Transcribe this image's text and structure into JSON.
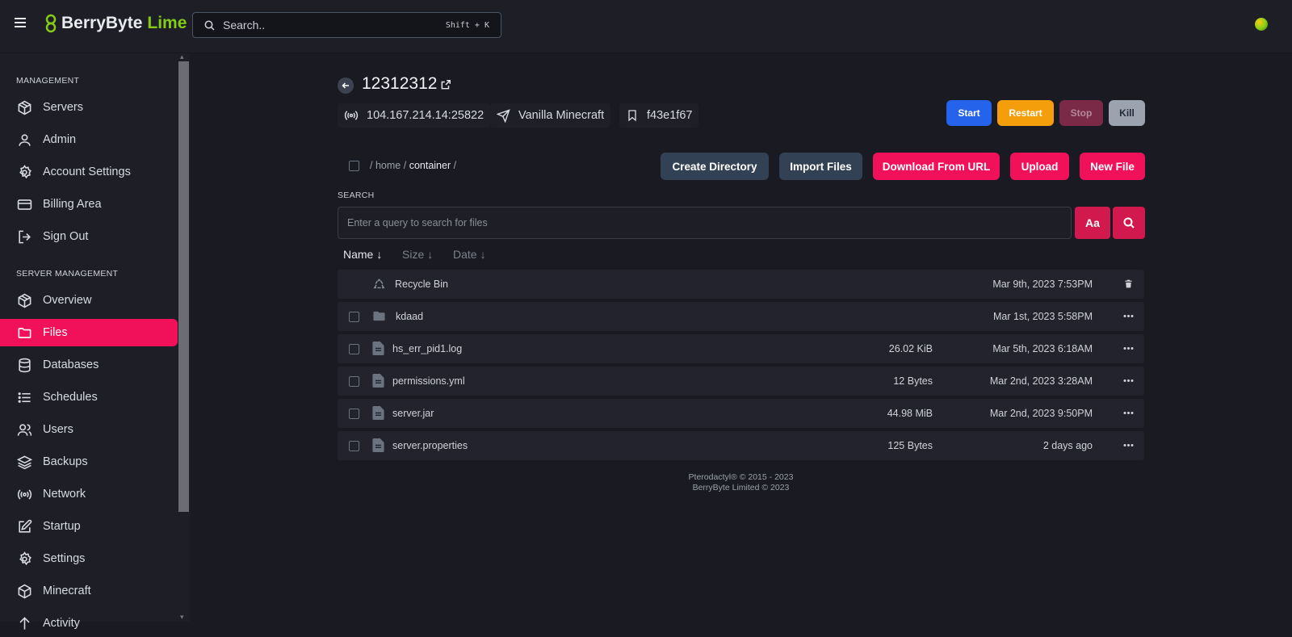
{
  "app": {
    "brand_name": "BerryByte",
    "brand_suffix": "Lime",
    "search_placeholder": "Search..",
    "search_shortcut": "Shift + K"
  },
  "sidebar": {
    "management_label": "MANAGEMENT",
    "management_items": [
      {
        "label": "Servers",
        "icon": "cube-icon"
      },
      {
        "label": "Admin",
        "icon": "user-icon"
      },
      {
        "label": "Account Settings",
        "icon": "gear-icon"
      },
      {
        "label": "Billing Area",
        "icon": "credit-card-icon"
      },
      {
        "label": "Sign Out",
        "icon": "sign-out-icon"
      }
    ],
    "server_label": "SERVER MANAGEMENT",
    "server_items": [
      {
        "label": "Overview",
        "icon": "cube-icon"
      },
      {
        "label": "Files",
        "icon": "folder-icon",
        "active": true
      },
      {
        "label": "Databases",
        "icon": "database-icon"
      },
      {
        "label": "Schedules",
        "icon": "list-icon"
      },
      {
        "label": "Users",
        "icon": "users-icon"
      },
      {
        "label": "Backups",
        "icon": "layers-icon"
      },
      {
        "label": "Network",
        "icon": "broadcast-icon"
      },
      {
        "label": "Startup",
        "icon": "edit-icon"
      },
      {
        "label": "Settings",
        "icon": "gear-icon"
      },
      {
        "label": "Minecraft",
        "icon": "box-icon"
      },
      {
        "label": "Activity",
        "icon": "activity-icon"
      }
    ]
  },
  "server": {
    "name": "12312312",
    "address": "104.167.214.14:25822",
    "egg": "Vanilla Minecraft",
    "id": "f43e1f67"
  },
  "power": {
    "start": "Start",
    "restart": "Restart",
    "stop": "Stop",
    "kill": "Kill"
  },
  "files": {
    "breadcrumb": {
      "sep": "/",
      "home": "home",
      "container": "container"
    },
    "actions": {
      "create_directory": "Create Directory",
      "import_files": "Import Files",
      "download_url": "Download From URL",
      "upload": "Upload",
      "new_file": "New File"
    },
    "search_label": "SEARCH",
    "search_placeholder": "Enter a query to search for files",
    "case_button": "Aa",
    "sort": {
      "name": "Name",
      "size": "Size",
      "date": "Date"
    },
    "rows": [
      {
        "name": "Recycle Bin",
        "size": "",
        "date": "Mar 9th, 2023 7:53PM",
        "type": "recycle"
      },
      {
        "name": "kdaad",
        "size": "",
        "date": "Mar 1st, 2023 5:58PM",
        "type": "folder"
      },
      {
        "name": "hs_err_pid1.log",
        "size": "26.02 KiB",
        "date": "Mar 5th, 2023 6:18AM",
        "type": "file"
      },
      {
        "name": "permissions.yml",
        "size": "12 Bytes",
        "date": "Mar 2nd, 2023 3:28AM",
        "type": "file"
      },
      {
        "name": "server.jar",
        "size": "44.98 MiB",
        "date": "Mar 2nd, 2023 9:50PM",
        "type": "file"
      },
      {
        "name": "server.properties",
        "size": "125 Bytes",
        "date": "2 days ago",
        "type": "file"
      }
    ]
  },
  "footer": {
    "line1": "Pterodactyl® © 2015 - 2023",
    "line2": "BerryByte Limited © 2023"
  },
  "colors": {
    "accent": "#f0115a",
    "brand_lime": "#84cc16",
    "start": "#2563eb",
    "restart": "#f59e0b",
    "stop": "#7a2a46",
    "kill": "#9ca3af"
  }
}
